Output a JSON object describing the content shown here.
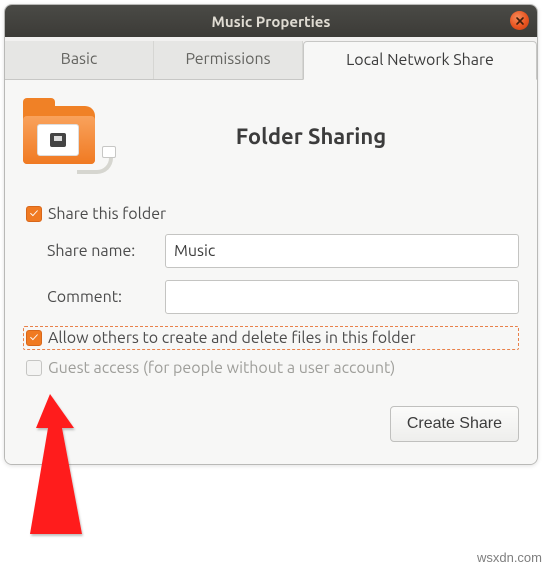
{
  "window": {
    "title": "Music Properties"
  },
  "tabs": {
    "basic": "Basic",
    "permissions": "Permissions",
    "local_share": "Local Network Share"
  },
  "share": {
    "heading": "Folder Sharing",
    "share_this_folder_label": "Share this folder",
    "share_name_label": "Share name:",
    "share_name_value": "Music",
    "comment_label": "Comment:",
    "comment_value": "",
    "allow_label": "Allow others to create and delete files in this folder",
    "guest_label": "Guest access (for people without a user account)",
    "create_btn": "Create Share"
  },
  "watermark": "wsxdn.com"
}
